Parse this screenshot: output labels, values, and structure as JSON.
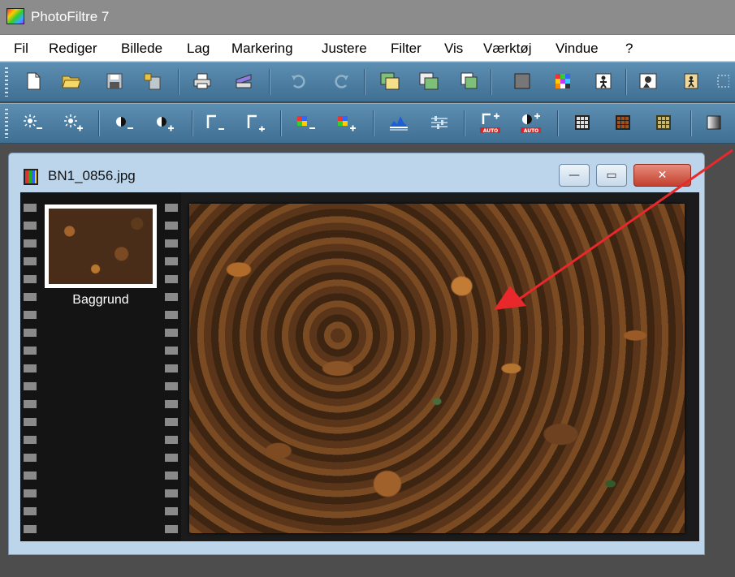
{
  "app": {
    "title": "PhotoFiltre 7"
  },
  "menu": [
    "Fil",
    "Rediger",
    "Billede",
    "Lag",
    "Markering",
    "Justere",
    "Filter",
    "Vis",
    "Værktøj",
    "Vindue",
    "?"
  ],
  "document": {
    "filename": "BN1_0856.jpg",
    "layers": [
      {
        "name": "Baggrund"
      }
    ]
  },
  "colors": {
    "toolbar": "#4f82a6",
    "annotation_arrow": "#e8282a"
  }
}
